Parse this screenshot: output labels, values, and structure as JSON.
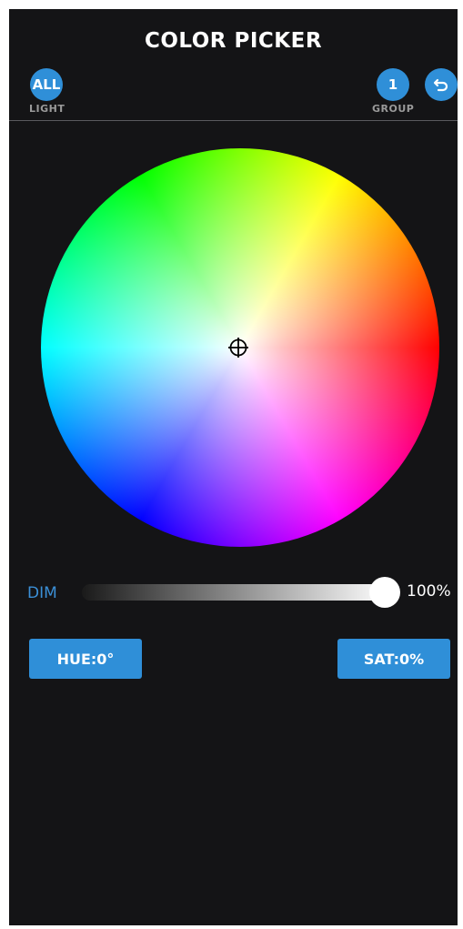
{
  "header": {
    "title": "COLOR PICKER"
  },
  "light_button": {
    "label": "ALL",
    "caption": "LIGHT"
  },
  "group_button": {
    "label": "1",
    "caption": "GROUP"
  },
  "back_button": {
    "icon": "undo-arrow-icon"
  },
  "color_wheel": {
    "selected_hue_deg": 0,
    "selected_saturation": 0
  },
  "dim": {
    "label": "DIM",
    "value_text": "100%",
    "level": 1.0
  },
  "hue_button": {
    "label": "HUE:0°"
  },
  "sat_button": {
    "label": "SAT:0%"
  },
  "colors": {
    "accent": "#2f8fd8",
    "background": "#141416",
    "dim_label": "#3b8fd6"
  }
}
